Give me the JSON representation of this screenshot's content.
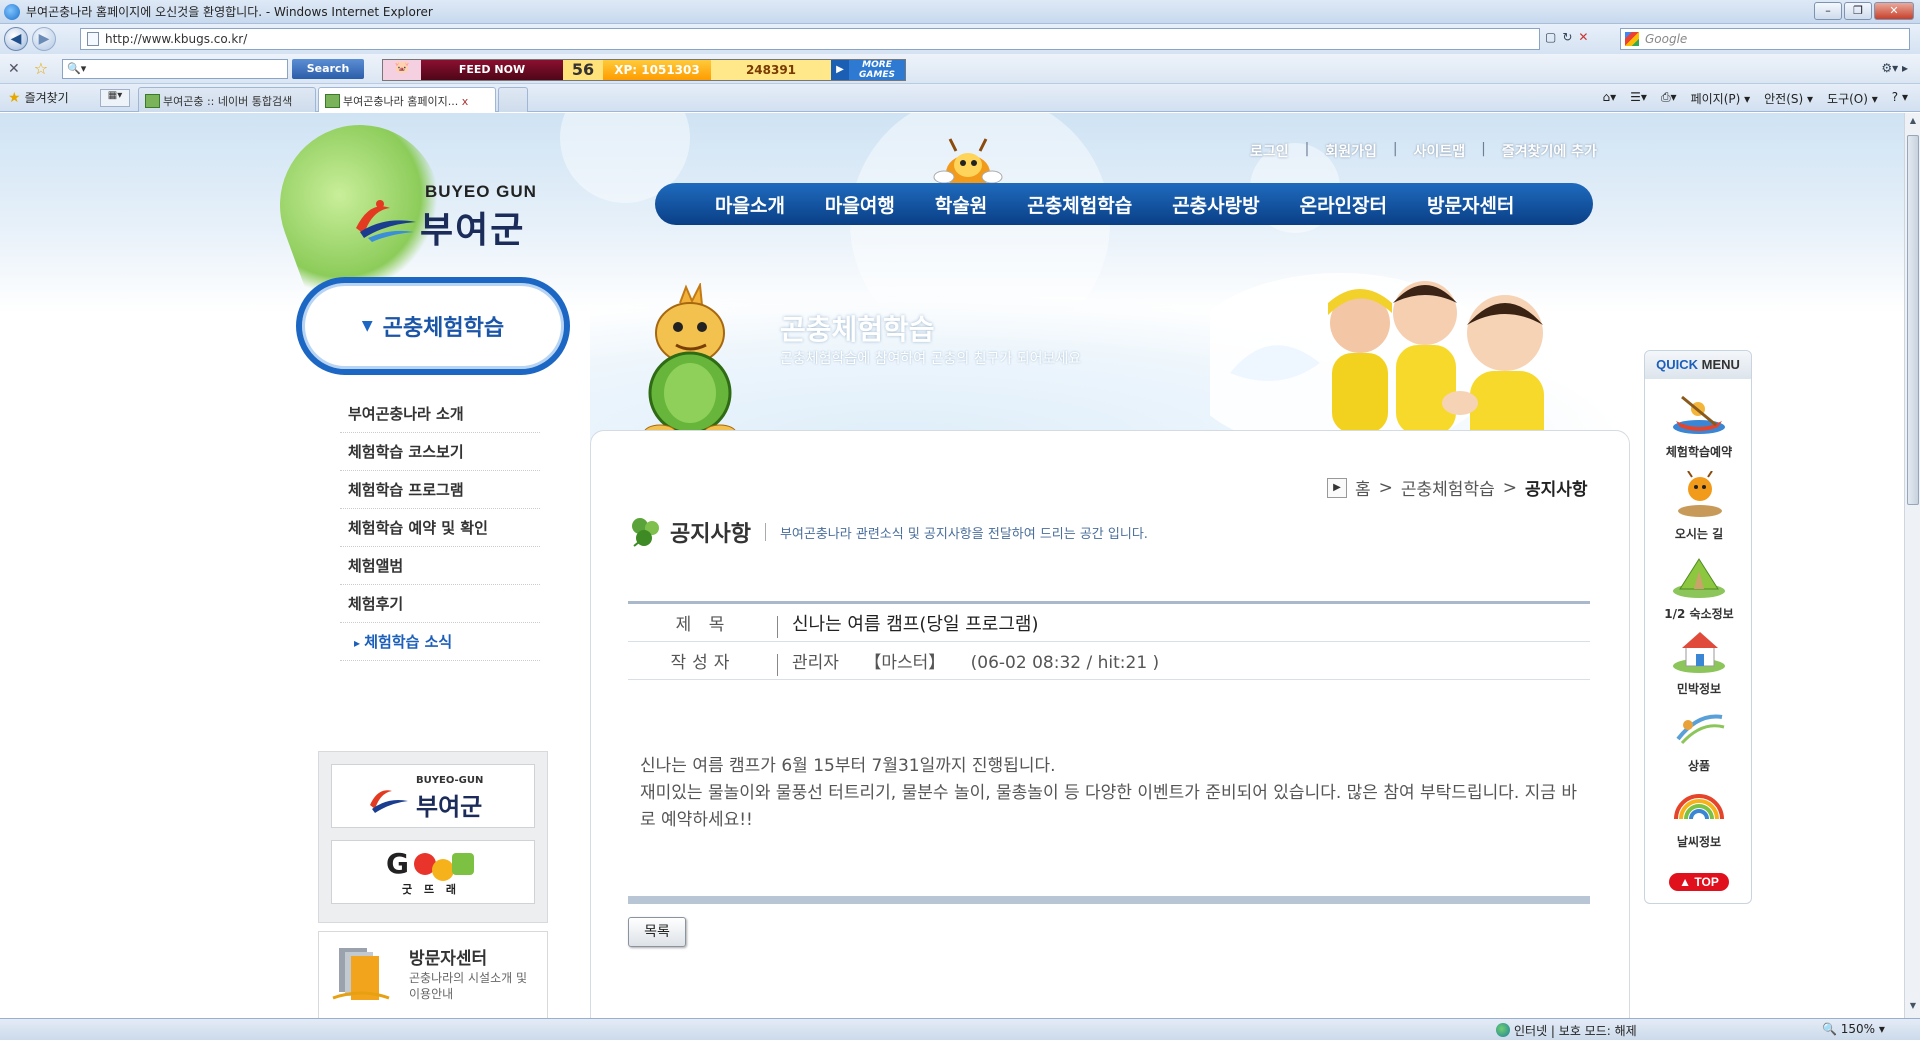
{
  "browser": {
    "window_title": "부여곤충나라 홈페이지에 오신것을 환영합니다. - Windows Internet Explorer",
    "url": "http://www.kbugs.co.kr/",
    "search_engine_placeholder": "Google",
    "toolbar_search_label": "Search",
    "game_toolbar": {
      "feed_label": "FEED NOW",
      "level": "56",
      "xp": "XP: 1051303",
      "coins": "248391",
      "more_label": "MORE GAMES"
    },
    "favorites_label": "즐겨찾기",
    "tabs": [
      {
        "label": "부여곤충 :: 네이버 통합검색"
      },
      {
        "label": "부여곤충나라 홈페이지..."
      }
    ],
    "tab_close": "x",
    "command_bar": {
      "page": "페이지(P) ▾",
      "safety": "안전(S) ▾",
      "tools": "도구(O) ▾",
      "help": "? ▾"
    },
    "status_bar": {
      "zone": "인터넷 | 보호 모드: 해제",
      "zoom": "150%"
    }
  },
  "header": {
    "logo_en": "BUYEO GUN",
    "logo_ko": "부여군",
    "util_links": [
      "로그인",
      "회원가입",
      "사이트맵",
      "즐겨찾기에 추가"
    ],
    "gnb": [
      "마을소개",
      "마을여행",
      "학술원",
      "곤충체험학습",
      "곤충사랑방",
      "온라인장터",
      "방문자센터"
    ]
  },
  "banner": {
    "title": "곤충체험학습",
    "subtitle": "곤충체험학습에 참여하여 곤충의 친구가 되어보세요"
  },
  "sidebar": {
    "section_title": "곤충체험학습",
    "items": [
      {
        "label": "부여곤충나라 소개",
        "active": false
      },
      {
        "label": "체험학습 코스보기",
        "active": false
      },
      {
        "label": "체험학습  프로그램",
        "active": false
      },
      {
        "label": "체험학습 예약 및 확인",
        "active": false
      },
      {
        "label": "체험앨범",
        "active": false
      },
      {
        "label": "체험후기",
        "active": false
      },
      {
        "label": "체험학습 소식",
        "active": true
      }
    ],
    "banner_buyeo_en": "BUYEO-GUN",
    "banner_buyeo_ko": "부여군",
    "banner_good_logo": "G",
    "banner_good_ko": "굿 뜨 래",
    "visitor_title": "방문자센터",
    "visitor_desc": "곤충나라의 시설소개 및 이용안내"
  },
  "breadcrumb": {
    "home": "홈",
    "section": "곤충체험학습",
    "current": "공지사항",
    "separator": ">"
  },
  "section": {
    "title": "공지사항",
    "description": "부여곤충나라 관련소식 및 공지사항을 전달하여 드리는 공간 입니다."
  },
  "post": {
    "subject_label": "제 목",
    "subject": "신나는 여름 캠프(당일 프로그램)",
    "author_label": "작성자",
    "author": "관리자",
    "author_role": "【마스터】",
    "meta": "(06-02 08:32 / hit:21 )",
    "body_lines": [
      "신나는 여름 캠프가 6월 15부터 7월31일까지 진행됩니다.",
      "재미있는 물놀이와 물풍선 터트리기, 물분수 놀이, 물총놀이 등 다양한 이벤트가 준비되어 있습니다. 많은 참여 부탁드립니다. 지금 바로 예약하세요!!"
    ],
    "list_button": "목록"
  },
  "quick_menu": {
    "title_1": "QUICK",
    "title_2": "MENU",
    "items": [
      {
        "label": "체험학습예약",
        "icon": "canoe-icon"
      },
      {
        "label": "오시는 길",
        "icon": "map-icon"
      },
      {
        "label": "1/2 숙소정보",
        "icon": "tent-icon"
      },
      {
        "label": "민박정보",
        "icon": "house-icon"
      },
      {
        "label": "상품",
        "icon": "gift-icon"
      },
      {
        "label": "날씨정보",
        "icon": "rainbow-icon"
      }
    ],
    "top_label": "▲ TOP"
  },
  "colors": {
    "gnb": "#0a3f86",
    "accent_blue": "#1c66c4",
    "top_button": "#e0101c"
  }
}
